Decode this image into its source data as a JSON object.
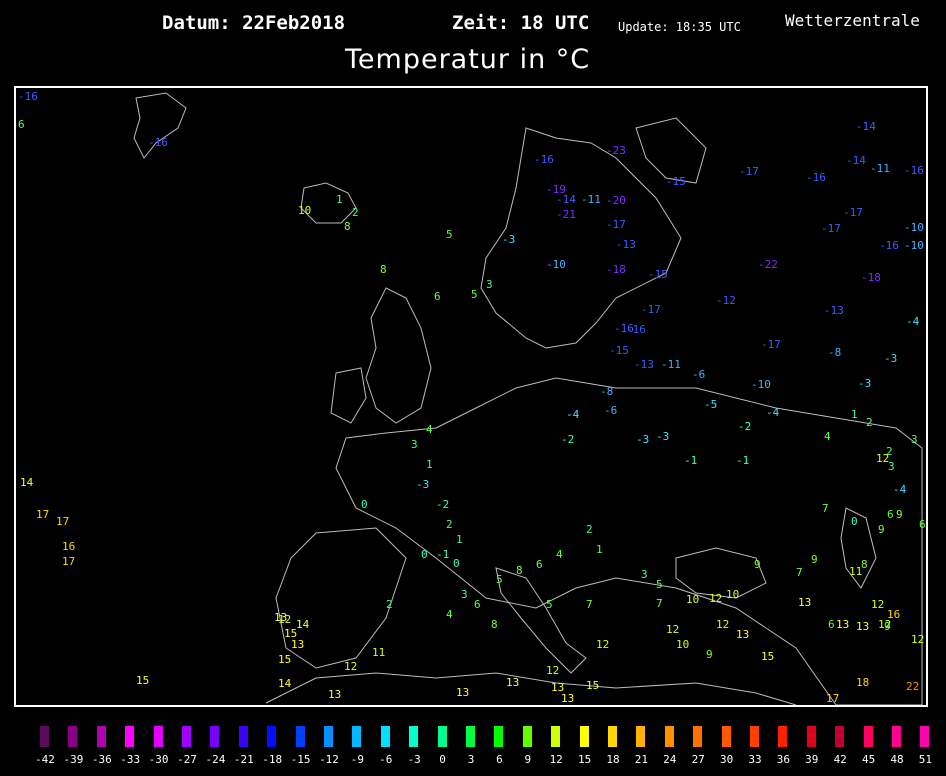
{
  "header": {
    "date": "Datum: 22Feb2018",
    "time": "Zeit: 18 UTC",
    "update": "Update: 18:35 UTC",
    "brand": "Wetterzentrale",
    "title": "Temperatur in °C"
  },
  "legend": {
    "labels": [
      "-42",
      "-39",
      "-36",
      "-33",
      "-30",
      "-27",
      "-24",
      "-21",
      "-18",
      "-15",
      "-12",
      "-9",
      "-6",
      "-3",
      "0",
      "3",
      "6",
      "9",
      "12",
      "15",
      "18",
      "21",
      "24",
      "27",
      "30",
      "33",
      "36",
      "39",
      "42",
      "45",
      "48",
      "51"
    ],
    "colors": [
      "#5a0b5a",
      "#880088",
      "#b000b0",
      "#ff00ff",
      "#e000ff",
      "#a000ff",
      "#7800ff",
      "#3c00ff",
      "#0010ff",
      "#0040ff",
      "#0090ff",
      "#00b8ff",
      "#00e0ff",
      "#00ffcc",
      "#00ff90",
      "#00ff40",
      "#00ff00",
      "#60ff00",
      "#d0ff00",
      "#ffff00",
      "#ffd800",
      "#ffb000",
      "#ff9000",
      "#ff7000",
      "#ff5800",
      "#ff4000",
      "#ff2000",
      "#e00020",
      "#c00030",
      "#ff0060",
      "#ff0090",
      "#ff00b0"
    ]
  },
  "stations": [
    {
      "t": "-16"
    },
    {
      "t": "6"
    },
    {
      "t": "-16"
    },
    {
      "t": "10"
    },
    {
      "t": "1"
    },
    {
      "t": "8"
    },
    {
      "t": "2"
    },
    {
      "t": "8"
    },
    {
      "t": "5"
    },
    {
      "t": "6"
    },
    {
      "t": "5"
    },
    {
      "t": "3"
    },
    {
      "t": "-3"
    },
    {
      "t": "-16"
    },
    {
      "t": "-23"
    },
    {
      "t": "-19"
    },
    {
      "t": "-14"
    },
    {
      "t": "-11"
    },
    {
      "t": "-20"
    },
    {
      "t": "-21"
    },
    {
      "t": "-17"
    },
    {
      "t": "-10"
    },
    {
      "t": "-18"
    },
    {
      "t": "-13"
    },
    {
      "t": "-15"
    },
    {
      "t": "-17"
    },
    {
      "t": "-16"
    },
    {
      "t": "-14"
    },
    {
      "t": "-17"
    },
    {
      "t": "-16"
    },
    {
      "t": "-14"
    },
    {
      "t": "-11"
    },
    {
      "t": "-16"
    },
    {
      "t": "-17"
    },
    {
      "t": "-17"
    },
    {
      "t": "-10"
    },
    {
      "t": "-16"
    },
    {
      "t": "-10"
    },
    {
      "t": "-22"
    },
    {
      "t": "-15"
    },
    {
      "t": "-18"
    },
    {
      "t": "-12"
    },
    {
      "t": "-13"
    },
    {
      "t": "-4"
    },
    {
      "t": "-17"
    },
    {
      "t": "-8"
    },
    {
      "t": "-3"
    },
    {
      "t": "-10"
    },
    {
      "t": "-3"
    },
    {
      "t": "-5"
    },
    {
      "t": "-4"
    },
    {
      "t": "-2"
    },
    {
      "t": "-16"
    },
    {
      "t": "-15"
    },
    {
      "t": "-13"
    },
    {
      "t": "-11"
    },
    {
      "t": "-6"
    },
    {
      "t": "-8"
    },
    {
      "t": "-6"
    },
    {
      "t": "-4"
    },
    {
      "t": "-2"
    },
    {
      "t": "-3"
    },
    {
      "t": "-3"
    },
    {
      "t": "-1"
    },
    {
      "t": "-1"
    },
    {
      "t": "4"
    },
    {
      "t": "1"
    },
    {
      "t": "2"
    },
    {
      "t": "3"
    },
    {
      "t": "2"
    },
    {
      "t": "-4"
    },
    {
      "t": "9"
    },
    {
      "t": "12"
    },
    {
      "t": "3"
    },
    {
      "t": "7"
    },
    {
      "t": "0"
    },
    {
      "t": "6"
    },
    {
      "t": "9"
    },
    {
      "t": "6"
    },
    {
      "t": "8"
    },
    {
      "t": "11"
    },
    {
      "t": "12"
    },
    {
      "t": "13"
    },
    {
      "t": "13"
    },
    {
      "t": "12"
    },
    {
      "t": "15"
    },
    {
      "t": "12"
    },
    {
      "t": "10"
    },
    {
      "t": "9"
    },
    {
      "t": "7"
    },
    {
      "t": "9"
    },
    {
      "t": "6"
    },
    {
      "t": "13"
    },
    {
      "t": "16"
    },
    {
      "t": "9"
    },
    {
      "t": "17"
    },
    {
      "t": "12"
    },
    {
      "t": "18"
    },
    {
      "t": "22"
    },
    {
      "t": "14"
    },
    {
      "t": "17"
    },
    {
      "t": "17"
    },
    {
      "t": "16"
    },
    {
      "t": "17"
    },
    {
      "t": "15"
    },
    {
      "t": "12"
    },
    {
      "t": "13"
    },
    {
      "t": "15"
    },
    {
      "t": "14"
    },
    {
      "t": "15"
    },
    {
      "t": "13"
    },
    {
      "t": "12"
    },
    {
      "t": "11"
    },
    {
      "t": "13"
    },
    {
      "t": "15"
    },
    {
      "t": "13"
    },
    {
      "t": "12"
    },
    {
      "t": "13"
    },
    {
      "t": "14"
    },
    {
      "t": "12"
    },
    {
      "t": "13"
    },
    {
      "t": "13"
    },
    {
      "t": "12"
    },
    {
      "t": "10"
    },
    {
      "t": "9"
    },
    {
      "t": "7"
    },
    {
      "t": "5"
    },
    {
      "t": "3"
    },
    {
      "t": "1"
    },
    {
      "t": "2"
    },
    {
      "t": "4"
    },
    {
      "t": "6"
    },
    {
      "t": "8"
    },
    {
      "t": "5"
    },
    {
      "t": "3"
    },
    {
      "t": "0"
    },
    {
      "t": "1"
    },
    {
      "t": "-1"
    },
    {
      "t": "2"
    },
    {
      "t": "0"
    },
    {
      "t": "-2"
    },
    {
      "t": "-3"
    },
    {
      "t": "1"
    },
    {
      "t": "3"
    },
    {
      "t": "4"
    },
    {
      "t": "5"
    },
    {
      "t": "7"
    },
    {
      "t": "10"
    },
    {
      "t": "12"
    },
    {
      "t": "13"
    },
    {
      "t": "8"
    },
    {
      "t": "6"
    },
    {
      "t": "4"
    },
    {
      "t": "2"
    },
    {
      "t": "0"
    }
  ]
}
